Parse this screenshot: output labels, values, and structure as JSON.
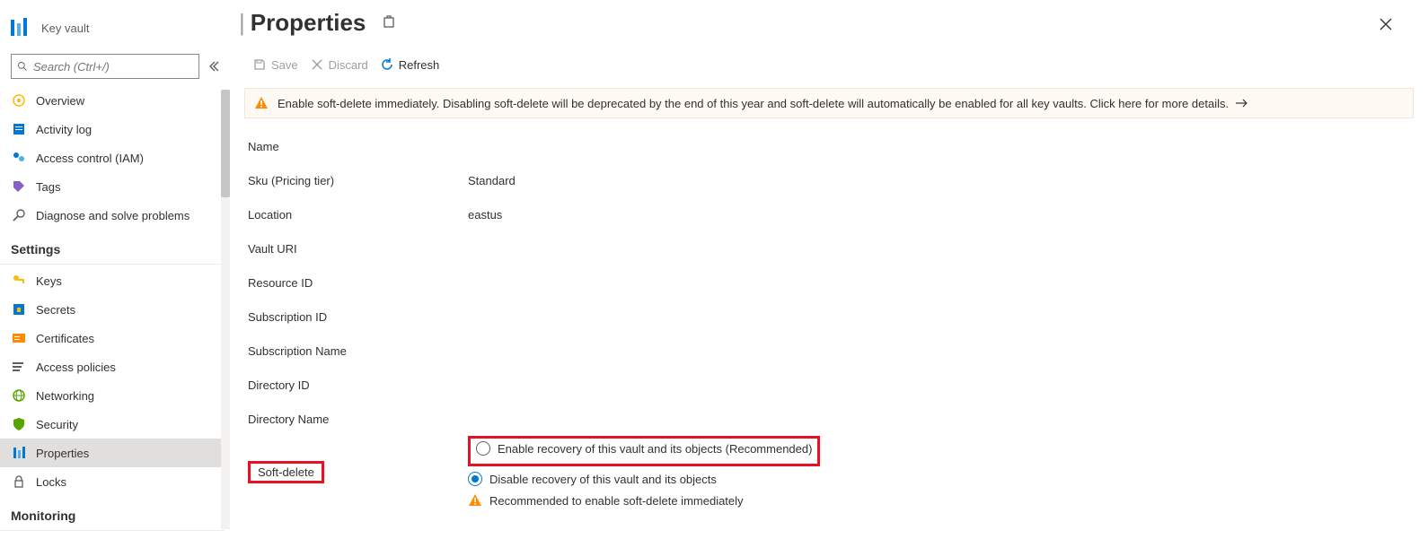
{
  "resource": {
    "type": "Key vault"
  },
  "search": {
    "placeholder": "Search (Ctrl+/)"
  },
  "nav": {
    "top": [
      {
        "id": "overview",
        "label": "Overview"
      },
      {
        "id": "activity-log",
        "label": "Activity log"
      },
      {
        "id": "access-control",
        "label": "Access control (IAM)"
      },
      {
        "id": "tags",
        "label": "Tags"
      },
      {
        "id": "diagnose",
        "label": "Diagnose and solve problems"
      }
    ],
    "settings_header": "Settings",
    "settings": [
      {
        "id": "keys",
        "label": "Keys"
      },
      {
        "id": "secrets",
        "label": "Secrets"
      },
      {
        "id": "certificates",
        "label": "Certificates"
      },
      {
        "id": "access-policies",
        "label": "Access policies"
      },
      {
        "id": "networking",
        "label": "Networking"
      },
      {
        "id": "security",
        "label": "Security"
      },
      {
        "id": "properties",
        "label": "Properties",
        "selected": true
      },
      {
        "id": "locks",
        "label": "Locks"
      }
    ],
    "monitoring_header": "Monitoring"
  },
  "header": {
    "title": "Properties"
  },
  "toolbar": {
    "save": "Save",
    "discard": "Discard",
    "refresh": "Refresh"
  },
  "banner": {
    "text": "Enable soft-delete immediately. Disabling soft-delete will be deprecated by the end of this year and soft-delete will automatically be enabled for all key vaults. Click here for more details."
  },
  "props": {
    "name_label": "Name",
    "sku_label": "Sku (Pricing tier)",
    "sku_value": "Standard",
    "location_label": "Location",
    "location_value": "eastus",
    "vault_uri_label": "Vault URI",
    "resource_id_label": "Resource ID",
    "subscription_id_label": "Subscription ID",
    "subscription_name_label": "Subscription Name",
    "directory_id_label": "Directory ID",
    "directory_name_label": "Directory Name",
    "soft_delete_label": "Soft-delete",
    "soft_delete": {
      "enable": "Enable recovery of this vault and its objects (Recommended)",
      "disable": "Disable recovery of this vault and its objects",
      "recommended": "Recommended to enable soft-delete immediately"
    }
  }
}
